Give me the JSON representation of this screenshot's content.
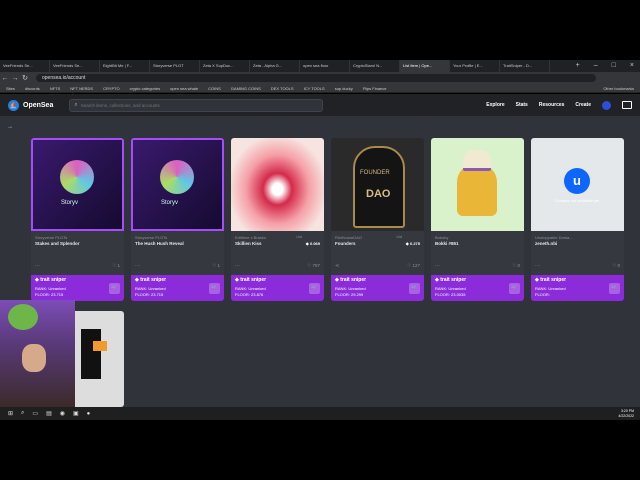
{
  "browser": {
    "tabs": [
      {
        "label": "VeeFriends Se..."
      },
      {
        "label": "VeeFriends Se..."
      },
      {
        "label": "EightBit Me | F..."
      },
      {
        "label": "Storyverse PLOT"
      },
      {
        "label": "Zeta X SupDuc..."
      },
      {
        "label": "Zeta - Alpha G..."
      },
      {
        "label": "open sea floor"
      },
      {
        "label": "CryptoSlam! N..."
      },
      {
        "label": "List Item | Ope..."
      },
      {
        "label": "Your Profile | E..."
      },
      {
        "label": "TraitSniper - D..."
      }
    ],
    "url": "opensea.io/account",
    "bookmarks": [
      "Sites",
      "discords",
      "NFTS",
      "NFT NERDS",
      "CRYPTO",
      "crypto categories",
      "open sea whale",
      "COINS",
      "GAMING COINS",
      "DEX TOOLS",
      "ICY TOOLS",
      "sup ducky",
      "Flips Finance"
    ],
    "other_bookmarks": "Other bookmarks"
  },
  "opensea": {
    "brand": "OpenSea",
    "search_placeholder": "Search items, collections, and accounts",
    "menu": [
      "Explore",
      "Stats",
      "Resources",
      "Create"
    ]
  },
  "cards": [
    {
      "collection": "Storyverse PLOTs",
      "name": "Stakes and Splendor",
      "price_label": "",
      "price": "",
      "likes": "1",
      "rank": "RANK: Unranked",
      "floor": "FLOOR: 23.715"
    },
    {
      "collection": "Storyverse PLOTs",
      "name": "The Hush Hush Reveal",
      "price_label": "",
      "price": "",
      "likes": "1",
      "rank": "RANK: Unranked",
      "floor": "FLOOR: 23.715"
    },
    {
      "collection": "Edifiéne x Brasko",
      "name": "Skillien Kiss",
      "price_label": "List",
      "price": "0.069",
      "likes": "797",
      "rank": "RANK: Unranked",
      "floor": "FLOOR: 23.876"
    },
    {
      "collection": "RisiHouseDAO",
      "name": "Founders",
      "price_label": "List",
      "price": "0.275",
      "likes": "127",
      "rank": "RANK: Unranked",
      "floor": "FLOOR: 29.299"
    },
    {
      "collection": "Bokuby",
      "name": "Bokki #861",
      "price_label": "",
      "price": "",
      "likes": "0",
      "rank": "RANK: Unranked",
      "floor": "FLOOR: 23.0035"
    },
    {
      "collection": "Unstoppable Doma...",
      "name": "zeneth.nbi",
      "price_label": "",
      "price": "",
      "likes": "0",
      "rank": "RANK: Unranked",
      "floor": "FLOOR:"
    }
  ],
  "trait_sniper_title": "trait sniper",
  "unavailable_text": "Content not available yet",
  "storyverse_word": "Storyv",
  "founder_text": "FOUNDER",
  "dao_text": "DAO",
  "taskbar": {
    "time": "3:20 PM",
    "date": "4/22/2022"
  }
}
